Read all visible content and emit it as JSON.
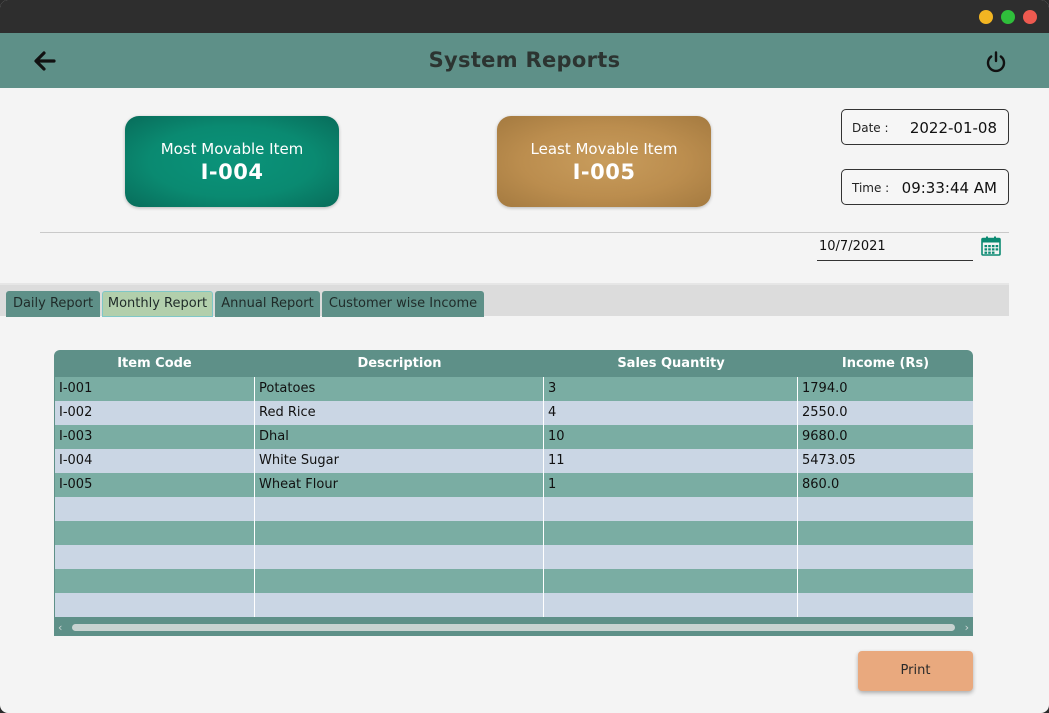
{
  "header": {
    "title": "System Reports"
  },
  "cards": {
    "most": {
      "label": "Most Movable Item",
      "value": "I-004"
    },
    "least": {
      "label": "Least Movable Item",
      "value": "I-005"
    }
  },
  "info": {
    "date_label": "Date :",
    "date_value": "2022-01-08",
    "time_label": "Time :",
    "time_value": "09:33:44 AM"
  },
  "date_picker": {
    "value": "10/7/2021"
  },
  "tabs": [
    {
      "label": "Daily Report"
    },
    {
      "label": "Monthly Report"
    },
    {
      "label": "Annual Report"
    },
    {
      "label": "Customer wise Income"
    }
  ],
  "active_tab": "Monthly Report",
  "table": {
    "columns": [
      "Item Code",
      "Description",
      "Sales Quantity",
      "Income (Rs)"
    ],
    "rows": [
      [
        "I-001",
        "Potatoes",
        "3",
        "1794.0"
      ],
      [
        "I-002",
        "Red Rice",
        "4",
        "2550.0"
      ],
      [
        "I-003",
        "Dhal",
        "10",
        "9680.0"
      ],
      [
        "I-004",
        "White Sugar",
        "11",
        "5473.05"
      ],
      [
        "I-005",
        "Wheat Flour",
        "1",
        "860.0"
      ],
      [
        "",
        "",
        "",
        ""
      ],
      [
        "",
        "",
        "",
        ""
      ],
      [
        "",
        "",
        "",
        ""
      ],
      [
        "",
        "",
        "",
        ""
      ],
      [
        "",
        "",
        "",
        ""
      ]
    ]
  },
  "print_button": {
    "label": "Print"
  },
  "icons": {
    "back": "back-arrow-icon",
    "power": "power-icon",
    "calendar": "calendar-icon",
    "scroll_left": "‹",
    "scroll_right": "›"
  },
  "colors": {
    "header": "#5e9088",
    "most_card": "#0a8a71",
    "least_card": "#bb8d4e",
    "row_odd": "#7aada3",
    "row_even": "#cad6e4",
    "print_button": "#e9a97e"
  }
}
